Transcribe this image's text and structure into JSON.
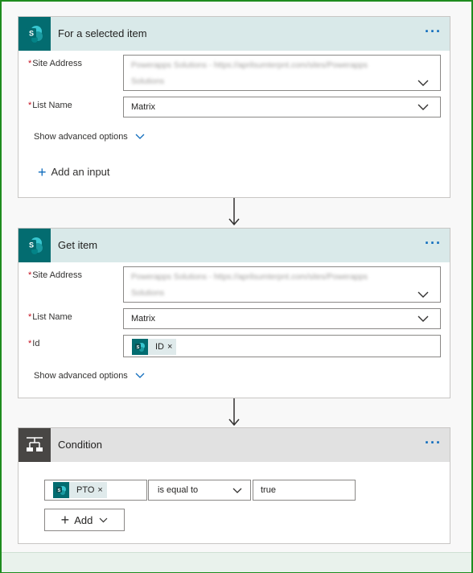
{
  "colors": {
    "frame": "#1e8c1e",
    "sharepoint": "#036c70",
    "accent": "#0f6cbd",
    "required": "#c50f1f"
  },
  "card1": {
    "title": "For a selected item",
    "more": "···",
    "site_label": "Site Address",
    "site_value": "Powerapps Solutions - https://aprilsumterpnt.com/sites/Powerapps",
    "site_value2": "Solutions",
    "list_label": "List Name",
    "list_value": "Matrix",
    "advanced": "Show advanced options",
    "add_input": "Add an input"
  },
  "card2": {
    "title": "Get item",
    "more": "···",
    "site_label": "Site Address",
    "site_value": "Powerapps Solutions - https://aprilsumterpnt.com/sites/Powerapps",
    "site_value2": "Solutions",
    "list_label": "List Name",
    "list_value": "Matrix",
    "id_label": "Id",
    "id_token": "ID",
    "token_remove": "×",
    "advanced": "Show advanced options"
  },
  "condition": {
    "title": "Condition",
    "more": "···",
    "left_token": "PTO",
    "token_remove": "×",
    "operator": "is equal to",
    "right_value": "true",
    "add_label": "Add"
  },
  "icons": {
    "sharepoint": "sharepoint-icon",
    "condition": "condition-icon",
    "arrow": "down-arrow-icon"
  },
  "required_mark": "*",
  "plus": "+"
}
